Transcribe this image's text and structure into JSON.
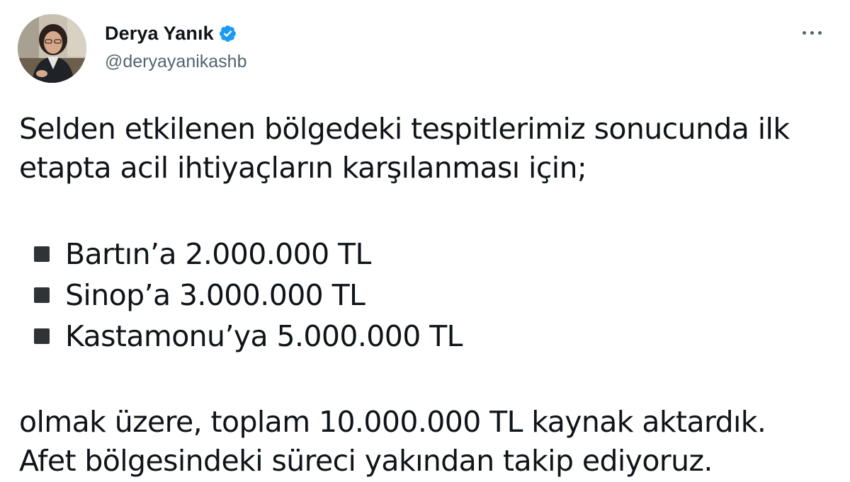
{
  "author": {
    "display_name": "Derya Yanık",
    "handle": "@deryayanikashb",
    "verified": true,
    "avatar_icon": "profile-photo"
  },
  "menu": {
    "icon": "more-horizontal-icon"
  },
  "tweet": {
    "intro_lines": [
      "Selden etkilenen bölgedeki tespitlerimiz sonucunda ilk",
      "etapta acil ihtiyaçların karşılanması için;"
    ],
    "bullets": [
      "Bartın’a 2.000.000 TL",
      "Sinop’a 3.000.000 TL",
      "Kastamonu’ya 5.000.000 TL"
    ],
    "outro_lines": [
      "olmak üzere, toplam 10.000.000 TL kaynak aktardık.",
      "Afet bölgesindeki süreci yakından takip ediyoruz."
    ]
  },
  "colors": {
    "text_primary": "#0f1419",
    "text_secondary": "#536471",
    "verified_blue": "#1d9bf0",
    "bullet": "#2f3336"
  }
}
